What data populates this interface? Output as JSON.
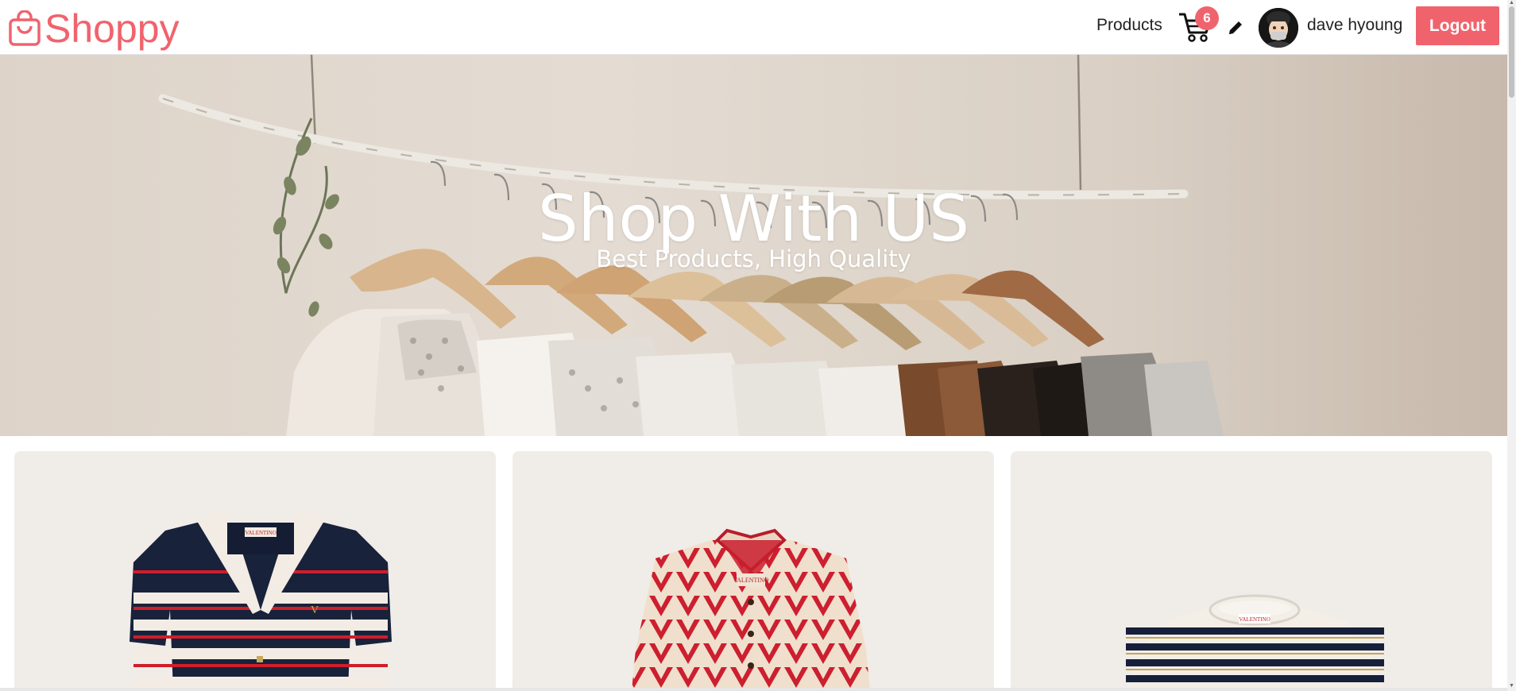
{
  "navbar": {
    "brand": "Shoppy",
    "products_link": "Products",
    "cart_count": "6",
    "username": "dave hyoung",
    "logout_label": "Logout",
    "icons": [
      "shopping-bag-icon",
      "cart-icon",
      "pencil-edit-icon",
      "user-avatar"
    ]
  },
  "hero": {
    "title": "Shop With US",
    "subtitle": "Best Products, High Quality"
  },
  "products": [
    {
      "image": "navy-red-white-striped-polo-cardigan"
    },
    {
      "image": "red-v-logo-print-shirt"
    },
    {
      "image": "navy-cream-striped-sweater"
    }
  ],
  "colors": {
    "accent": "#f0636d",
    "card_bg": "#f0ece8",
    "hero_bg": "#ddd3c9"
  }
}
